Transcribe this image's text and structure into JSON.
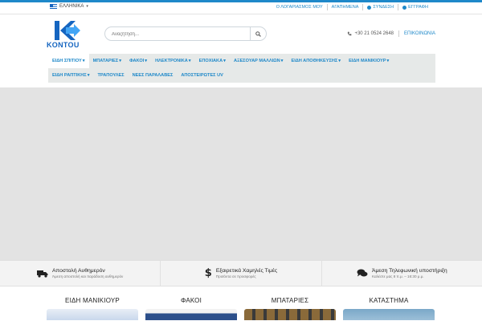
{
  "topbar": {
    "language": "ΕΛΛΗΝΙΚΑ",
    "links": [
      {
        "label": "Ο ΛΟΓΑΡΙΑΣΜΟΣ ΜΟΥ"
      },
      {
        "label": "ΑΓΑΠΗΜΕΝΑ"
      },
      {
        "label": "ΣΥΝΔΕΣΗ"
      },
      {
        "label": "ΕΓΓΡΑΦΗ"
      }
    ]
  },
  "logo": {
    "text": "KONTOU"
  },
  "search": {
    "placeholder": "Αναζήτηση..."
  },
  "contact": {
    "phone": "+30 21 0524 2648",
    "contact_label": "ΕΠΙΚΟΙΝΩΝΙΑ"
  },
  "nav": {
    "row1": [
      {
        "label": "ΕΙΔΗ ΣΠΙΤΙΟΥ",
        "dropdown": true
      },
      {
        "label": "ΜΠΑΤΑΡΙΕΣ",
        "dropdown": true
      },
      {
        "label": "ΦΑΚΟΙ",
        "dropdown": true
      },
      {
        "label": "ΗΛΕΚΤΡΟΝΙΚΑ",
        "dropdown": true
      },
      {
        "label": "ΕΠΟΧΙΑΚΑ",
        "dropdown": true
      },
      {
        "label": "ΑΞΕΣΟΥΑΡ ΜΑΛΛΙΩΝ",
        "dropdown": true
      },
      {
        "label": "ΕΙΔΗ ΑΠΟΘΗΚΕΥΣΗΣ",
        "dropdown": true
      },
      {
        "label": "ΕΙΔΗ ΜΑΝΙΚΙΟΥΡ",
        "dropdown": true
      }
    ],
    "row2": [
      {
        "label": "ΕΙΔΗ ΡΑΠΤΙΚΗΣ",
        "dropdown": true
      },
      {
        "label": "ΤΡΑΠΟΥΛΕΣ",
        "dropdown": false
      },
      {
        "label": "ΝΕΕΣ ΠΑΡΑΛΑΒΕΣ",
        "dropdown": false
      },
      {
        "label": "ΑΠΟΣΤΕΙΡΩΤΕΣ UV",
        "dropdown": false
      }
    ]
  },
  "features": [
    {
      "title": "Αποστολή Αυθημερόν",
      "subtitle": "Άμεση αποστολή και παράδοση αυθημερόν",
      "icon": "truck-icon"
    },
    {
      "title": "Εξαιρετικά Χαμηλές Τιμές",
      "subtitle": "Προϊόντα σε προσφορές",
      "icon": "dollar-icon"
    },
    {
      "title": "Άμεση Τηλεφωνική υποστήριξη",
      "subtitle": "Καλέστε μας 8 π.μ. – 16:30 μ.μ.",
      "icon": "chat-icon"
    }
  ],
  "categories": [
    {
      "title": "ΕΙΔΗ ΜΑΝΙΚΙΟΥΡ"
    },
    {
      "title": "ΦΑΚΟΙ"
    },
    {
      "title": "ΜΠΑΤΑΡΙΕΣ"
    },
    {
      "title": "ΚΑΤΑΣΤΗΜΑ"
    }
  ],
  "colors": {
    "accent": "#1e88c9",
    "logo": "#1565c0",
    "nav_bg": "#e6e9e8",
    "hero_bg": "#e3e3e3"
  }
}
